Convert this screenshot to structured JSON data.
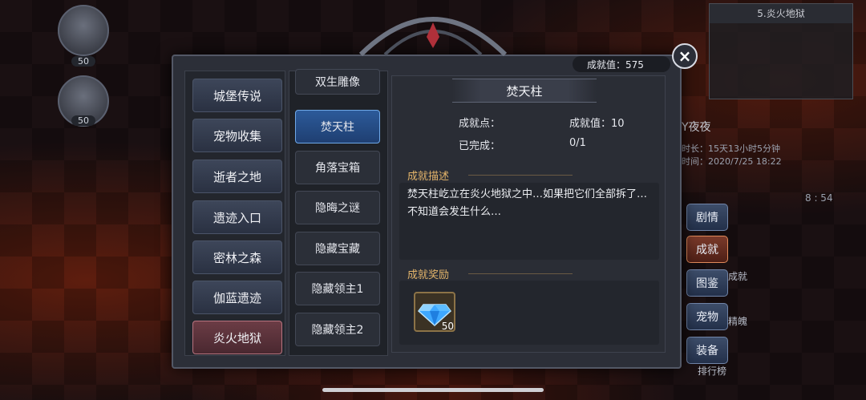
{
  "header": {
    "score_label": "成就值：575",
    "close_label": "×"
  },
  "minimap": {
    "title": "5.炎火地狱"
  },
  "portraits": [
    {
      "level": "50"
    },
    {
      "level": "50"
    }
  ],
  "side_info": {
    "player_name": "Y夜夜",
    "duration": "时长：15天13小时5分钟",
    "date": "时间：2020/7/25 18:22",
    "clock": "8 : 54"
  },
  "side_tabs": [
    {
      "label": "剧情",
      "sub": ""
    },
    {
      "label": "成就",
      "sub": "成就"
    },
    {
      "label": "图鉴",
      "sub": "精魄"
    },
    {
      "label": "宠物",
      "sub": ""
    },
    {
      "label": "装备",
      "sub": "排行榜"
    }
  ],
  "categories": [
    {
      "label": "城堡传说"
    },
    {
      "label": "宠物收集"
    },
    {
      "label": "逝者之地"
    },
    {
      "label": "遗迹入口"
    },
    {
      "label": "密林之森"
    },
    {
      "label": "伽蓝遗迹"
    },
    {
      "label": "炎火地狱"
    }
  ],
  "sub_items": [
    {
      "label": "双生雕像"
    },
    {
      "label": "焚天柱"
    },
    {
      "label": "角落宝箱"
    },
    {
      "label": "隐晦之谜"
    },
    {
      "label": "隐藏宝藏"
    },
    {
      "label": "隐藏领主1"
    },
    {
      "label": "隐藏领主2"
    }
  ],
  "detail": {
    "title": "焚天柱",
    "points_label": "成就点：",
    "points_value": "成就值：10",
    "completed_label": "已完成：",
    "completed_value": "0/1",
    "desc_title": "成就描述",
    "desc_text": "焚天柱屹立在炎火地狱之中…如果把它们全部拆了…不知道会发生什么…",
    "reward_title": "成就奖励",
    "reward_item": {
      "icon": "diamond-icon",
      "count": "50"
    }
  },
  "colors": {
    "active_category": "#6b3c45",
    "active_sub": "#2c5a9a",
    "section_title": "#e3b46a"
  }
}
